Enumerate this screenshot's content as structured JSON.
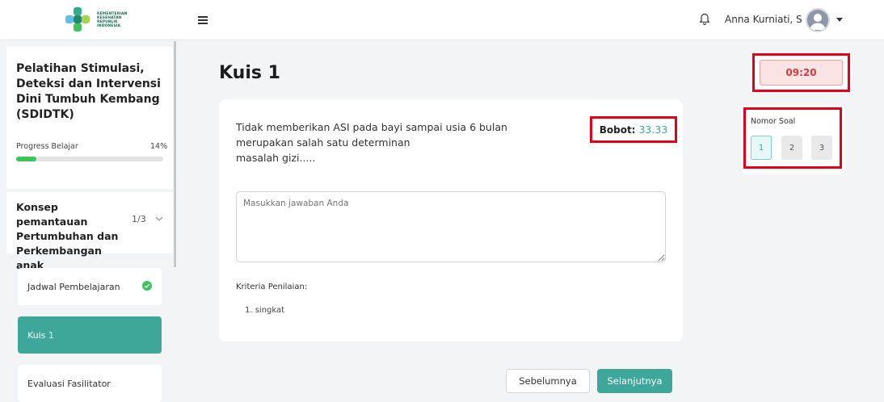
{
  "header": {
    "logo_text": [
      "KEMENTERIAN",
      "KESEHATAN",
      "REPUBLIK",
      "INDONESIA"
    ],
    "user_name": "Anna Kurniati, S ...",
    "icons": [
      "menu-icon",
      "bell-icon",
      "user-avatar-icon",
      "caret-down-icon"
    ]
  },
  "sidebar": {
    "course_title": "Pelatihan Stimulasi, Deteksi dan Intervensi Dini Tumbuh Kembang (SDIDTK)",
    "progress_label": "Progress Belajar",
    "progress_text": "14%",
    "progress_value": 0.14,
    "module_title": "Konsep pemantauan Pertumbuhan dan Perkembangan anak",
    "module_count": "1/3",
    "items": [
      {
        "label": "Jadwal Pembelajaran",
        "completed": true
      },
      {
        "label": "Kuis 1",
        "active": true
      },
      {
        "label": "Evaluasi Fasilitator"
      }
    ]
  },
  "main": {
    "title": "Kuis 1",
    "question": "Tidak memberikan ASI pada bayi sampai usia 6 bulan merupakan salah satu determinan masalah gizi.....",
    "question_lines": [
      "Tidak memberikan ASI pada bayi sampai usia 6 bulan",
      "merupakan salah satu determinan",
      "masalah gizi....."
    ],
    "bobot_label": "Bobot:",
    "bobot_value": "33.33",
    "answer_placeholder": "Masukkan jawaban Anda",
    "criteria_label": "Kriteria Penilaian:",
    "criteria_items": [
      "1. singkat"
    ],
    "prev_label": "Sebelumnya",
    "next_label": "Selanjutnya"
  },
  "timer": "09:20",
  "question_nav": {
    "title": "Nomor Soal",
    "numbers": [
      "1",
      "2",
      "3"
    ],
    "active": "1"
  },
  "colors": {
    "accent": "#3fa79a",
    "highlight_border": "#e4001b",
    "progress": "#3cc45b",
    "timer_bg": "#fde4e4"
  }
}
